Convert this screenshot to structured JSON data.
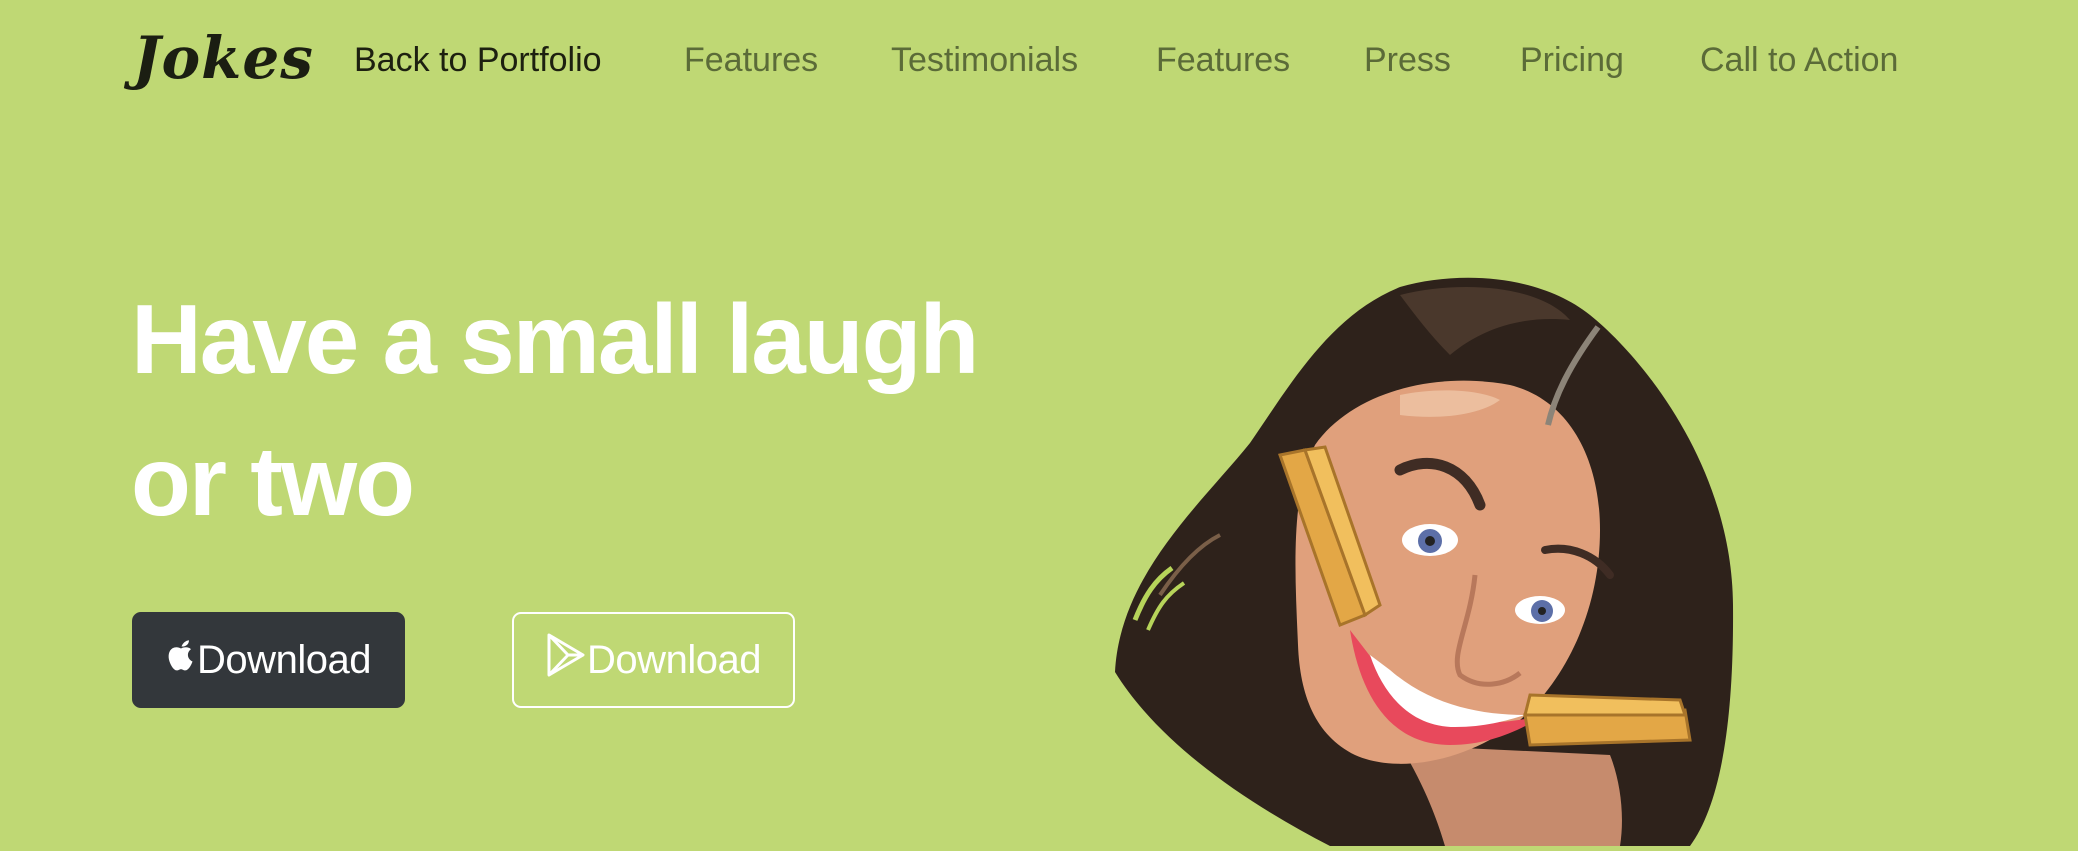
{
  "brand": {
    "name": "Jokes"
  },
  "nav": {
    "items": [
      {
        "label": "Back to Portfolio",
        "active": true
      },
      {
        "label": "Features"
      },
      {
        "label": "Testimonials"
      },
      {
        "label": "Features"
      },
      {
        "label": "Press"
      },
      {
        "label": "Pricing"
      },
      {
        "label": "Call to Action"
      }
    ]
  },
  "hero": {
    "title": "Have a small laugh or two",
    "buttons": [
      {
        "label": "Download",
        "icon": "apple-icon"
      },
      {
        "label": "Download",
        "icon": "google-play-icon"
      }
    ],
    "image": {
      "subject": "caricature of a woman with clothespins stretching her smile"
    }
  },
  "colors": {
    "background": "#bfd874",
    "nav_text": "#5b6b38",
    "nav_active": "#1d2010",
    "hero_text": "#ffffff",
    "apple_button": "#33373b"
  }
}
